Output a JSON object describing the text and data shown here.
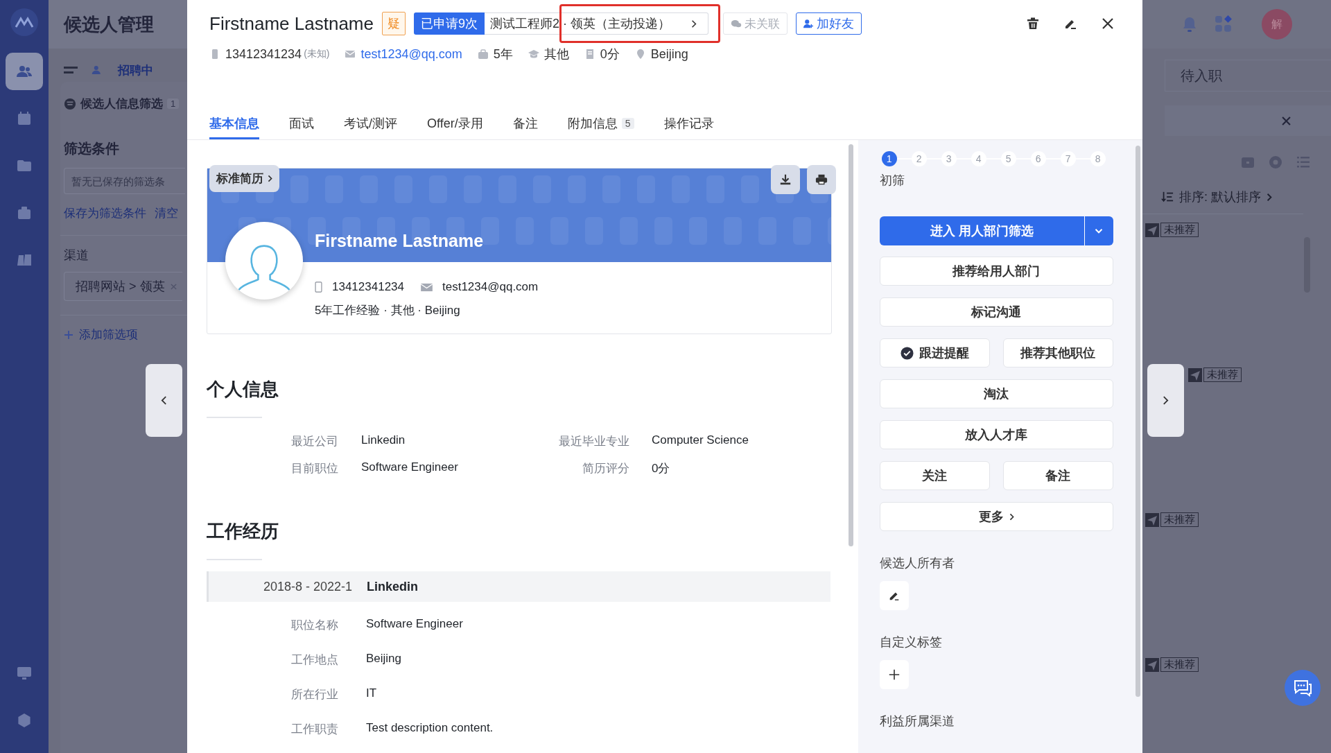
{
  "sidebar": {
    "items": [
      {
        "kind": "people",
        "selected": true
      },
      {
        "kind": "calendar",
        "selected": false
      },
      {
        "kind": "folder",
        "selected": false
      },
      {
        "kind": "bag",
        "selected": false
      },
      {
        "kind": "book",
        "selected": false
      }
    ],
    "bottom_items": [
      {
        "kind": "monitor",
        "selected": false
      },
      {
        "kind": "gear",
        "selected": false
      }
    ]
  },
  "page_title": "候选人管理",
  "toolbar": {
    "tab": "招聘中"
  },
  "filter_panel": {
    "title": "候选人信息筛选",
    "badge": "1",
    "section": "筛选条件",
    "placeholder": "暂无已保存的筛选条",
    "links": [
      "保存为筛选条件",
      "清空"
    ],
    "channel_label": "渠道",
    "channel_chip": "招聘网站 > 领英",
    "add_filter": "添加筛选项"
  },
  "right_panel": {
    "avatar": "解",
    "stage": "待入职",
    "sort": "排序: 默认排序",
    "tags": [
      {
        "label": "未推荐"
      },
      {
        "label": "未推荐"
      },
      {
        "label": "未推荐"
      },
      {
        "label": "未推荐"
      }
    ]
  },
  "candidate": {
    "name": "Firstname Lastname",
    "flag": "疑",
    "applied": "已申请9次",
    "position": "测试工程师2",
    "channel": "· 领英（主动投递）",
    "channel_highlighted": true,
    "wechat": {
      "label": "未关联",
      "disabled": true
    },
    "add_friend": "加好友",
    "contacts": [
      {
        "kind": "phone",
        "text": "13412341234",
        "note": "(未知)"
      },
      {
        "kind": "email",
        "text": "test1234@qq.com"
      },
      {
        "kind": "experience",
        "text": "5年"
      },
      {
        "kind": "education",
        "text": "其他"
      },
      {
        "kind": "score",
        "text": "0分"
      },
      {
        "kind": "location",
        "text": "Beijing"
      }
    ]
  },
  "tabs": [
    {
      "label": "基本信息",
      "selected": true
    },
    {
      "label": "面试",
      "selected": false
    },
    {
      "label": "考试/测评",
      "selected": false
    },
    {
      "label": "Offer/录用",
      "selected": false
    },
    {
      "label": "备注",
      "selected": false
    },
    {
      "label": "附加信息",
      "count": "5",
      "selected": false
    },
    {
      "label": "操作记录",
      "selected": false
    }
  ],
  "resume": {
    "template": "标准简历",
    "name": "Firstname Lastname",
    "phone": "13412341234",
    "email": "test1234@qq.com",
    "summary": "5年工作经验 · 其他 · Beijing"
  },
  "personal_info": {
    "title": "个人信息",
    "fields": [
      {
        "label": "最近公司",
        "value": "Linkedin"
      },
      {
        "label": "最近毕业专业",
        "value": "Computer Science"
      },
      {
        "label": "目前职位",
        "value": "Software Engineer"
      },
      {
        "label": "简历评分",
        "value": "0分"
      }
    ]
  },
  "work_experience": {
    "title": "工作经历",
    "entries": [
      {
        "period": "2018-8 - 2022-1",
        "company": "Linkedin",
        "fields": [
          {
            "label": "职位名称",
            "value": "Software Engineer"
          },
          {
            "label": "工作地点",
            "value": "Beijing"
          },
          {
            "label": "所在行业",
            "value": "IT"
          },
          {
            "label": "工作职责",
            "value": "Test description content."
          }
        ]
      }
    ]
  },
  "workflow": {
    "steps": [
      {
        "label": "1",
        "selected": true
      },
      {
        "label": "2",
        "selected": false
      },
      {
        "label": "3",
        "selected": false
      },
      {
        "label": "4",
        "selected": false
      },
      {
        "label": "5",
        "selected": false
      },
      {
        "label": "6",
        "selected": false
      },
      {
        "label": "7",
        "selected": false
      },
      {
        "label": "8",
        "selected": false
      }
    ],
    "current_stage": "初筛",
    "primary_action": "进入 用人部门筛选",
    "actions": [
      {
        "label": "推荐给用人部门",
        "kind": "wide"
      },
      {
        "label": "标记沟通",
        "kind": "wide"
      },
      {
        "label": "跟进提醒",
        "kind": "reminder"
      },
      {
        "label": "推荐其他职位",
        "kind": "half"
      },
      {
        "label": "淘汰",
        "kind": "wide"
      },
      {
        "label": "放入人才库",
        "kind": "wide"
      },
      {
        "label": "关注",
        "kind": "half"
      },
      {
        "label": "备注",
        "kind": "half"
      },
      {
        "label": "更多",
        "kind": "more"
      }
    ],
    "sections": [
      {
        "title": "候选人所有者",
        "kind": "edit"
      },
      {
        "title": "自定义标签",
        "kind": "add"
      },
      {
        "title": "利益所属渠道",
        "kind": "none"
      }
    ]
  }
}
